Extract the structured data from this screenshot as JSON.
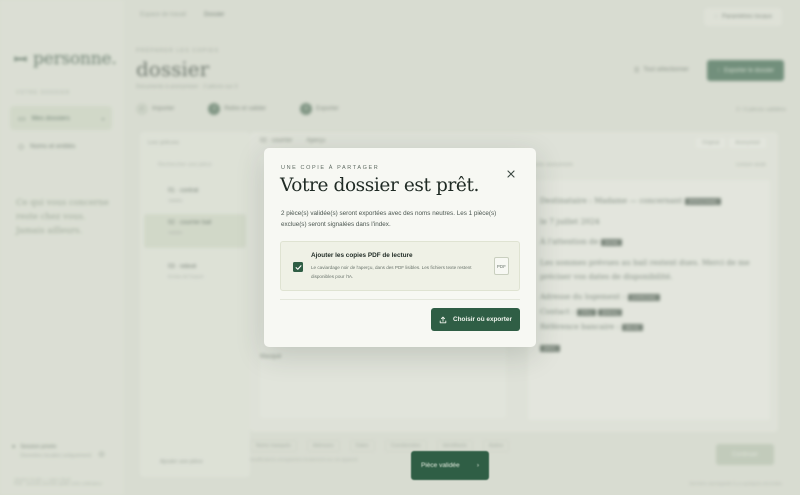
{
  "background": {
    "brand": {
      "logo_mark": "ꟷ",
      "name": "personne."
    },
    "topnav": [
      "Espace de travail",
      "Dossier"
    ],
    "top_button": "Paramètres locaux",
    "sidebar": {
      "section": "Votre dossier",
      "items": [
        {
          "label": "Mes dossiers",
          "icon": "folder-icon"
        },
        {
          "label": "Noms et entités",
          "icon": "tag-icon"
        }
      ],
      "quote": "Ce qui vous concerne reste chez vous. Jamais ailleurs.",
      "user_name": "Session privée",
      "user_sub": "Données locales uniquement",
      "footer": "Version locale — sans cloud"
    },
    "header": {
      "eyebrow": "Préparer les copies",
      "title": "dossier",
      "subtitle": "Documents à anonymiser · 2 pièces sur 3",
      "ghost_button": "Tout sélectionner",
      "primary_button": "Exporter le dossier"
    },
    "steps": [
      {
        "num": "",
        "label": "Importer"
      },
      {
        "num": "2",
        "label": "Relire et valider"
      },
      {
        "num": "3",
        "label": "Exporter"
      }
    ],
    "steps_right": "2 / 3 pièces validées",
    "list": {
      "header": "Les pièces",
      "search": "Rechercher une pièce",
      "items": [
        {
          "title": "01 · contrat",
          "sub": "Validée"
        },
        {
          "title": "02 · courrier bail",
          "sub": "Validée"
        },
        {
          "title": "03 · relevé",
          "sub": "Exclue de l'export"
        }
      ],
      "add": "Ajouter une pièce"
    },
    "document": {
      "tabs": [
        "02 · courrier",
        "Aperçu"
      ],
      "toggles": [
        "Original",
        "Anonymisé"
      ],
      "right_head_left": "Version anonymisée",
      "right_head_right": "Lecture seule",
      "redact_label": "Masqué",
      "paragraphs": [
        "Destinataire : Madame — concernant ",
        "le 7 juillet 2024 ",
        "À l'attention de ",
        "Les sommes prévues au bail restent dues. Merci de me préciser vos dates de disponibilité.",
        "Adresse du logement :",
        "Contact :",
        "Référence bancaire : "
      ],
      "tags": [
        "[PERSONNE]",
        "[ADRESSE]",
        "[EMAIL]",
        "[TÉL]",
        "[IBAN]",
        "[DATE]",
        "[NOM]",
        "[RÉF]"
      ]
    },
    "bottom_chips": [
      "Noms masqués",
      "Adresses",
      "Dates",
      "Coordonnées",
      "Identifiants",
      "Autres"
    ],
    "bottom_note": "Modifications enregistrées localement sur cet appareil.",
    "continue_button": "Continuer",
    "status_left": "Prêt · aucune donnée quitte votre ordinateur",
    "status_right": "Dernière sauvegarde il y a quelques secondes",
    "toast": {
      "label": "Pièce validée",
      "arrow": "›"
    }
  },
  "modal": {
    "eyebrow": "Une copie à partager",
    "title": "Votre dossier est prêt.",
    "body": "2 pièce(s) validée(s) seront exportées avec des noms neutres. Les 1 pièce(s) exclue(s) seront signalées dans l'index.",
    "option": {
      "checked": true,
      "title": "Ajouter les copies PDF de lecture",
      "description": "Le caviardage noir de l'aperçu, dans des PDF lisibles. Les fichiers texte restent disponibles pour l'IA.",
      "badge": "PDF"
    },
    "export_button": "Choisir où exporter",
    "close_icon": "close-icon"
  },
  "colors": {
    "primary": "#2f5e45",
    "modal_bg": "#f7f8f3",
    "card_bg": "#eff1e6"
  }
}
